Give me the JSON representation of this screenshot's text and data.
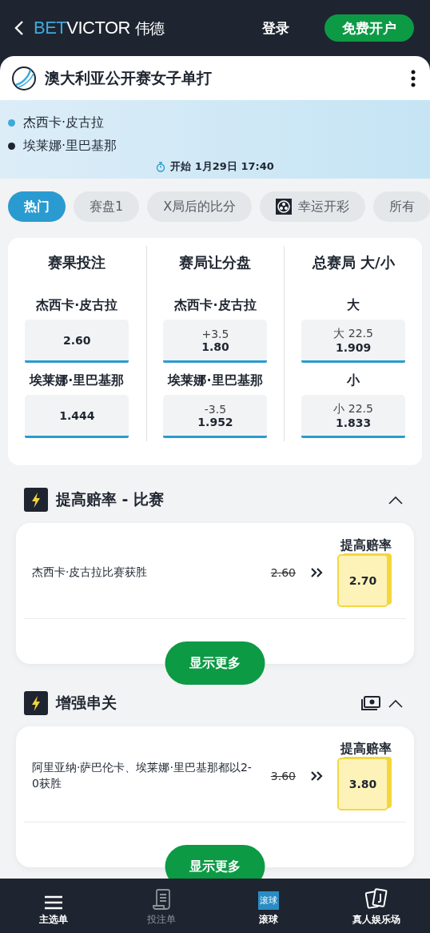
{
  "header": {
    "brand_bet": "BET",
    "brand_victor": "VICTOR",
    "brand_cn": "伟德",
    "login": "登录",
    "signup": "免费开户"
  },
  "event": {
    "title": "澳大利亚公开赛女子单打",
    "players": [
      {
        "name": "杰西卡·皮古拉",
        "color": "#3fa9dc"
      },
      {
        "name": "埃莱娜·里巴基那",
        "color": "#1e2530"
      }
    ],
    "start": "开始 1月29日 17:40"
  },
  "tabs": [
    {
      "label": "热门",
      "selected": true,
      "kind": "text"
    },
    {
      "label": "赛盘1",
      "selected": false,
      "kind": "text"
    },
    {
      "label": "X局后的比分",
      "selected": false,
      "kind": "text"
    },
    {
      "label": "幸运开彩",
      "selected": false,
      "kind": "lottery"
    },
    {
      "label": "所有",
      "selected": false,
      "kind": "text"
    }
  ],
  "markets": [
    {
      "title": "赛果投注",
      "selections": [
        {
          "label": "杰西卡·皮古拉",
          "odds": "2.60"
        },
        {
          "label": "埃莱娜·里巴基那",
          "odds": "1.444"
        }
      ]
    },
    {
      "title": "赛局让分盘",
      "selections": [
        {
          "label": "杰西卡·皮古拉",
          "line": "+3.5",
          "odds": "1.80"
        },
        {
          "label": "埃莱娜·里巴基那",
          "line": "-3.5",
          "odds": "1.952"
        }
      ]
    },
    {
      "title": "总赛局 大/小",
      "selections": [
        {
          "label": "大",
          "line": "大 22.5",
          "odds": "1.909"
        },
        {
          "label": "小",
          "line": "小 22.5",
          "odds": "1.833"
        }
      ]
    }
  ],
  "boost_sections": [
    {
      "title": "提高赔率 - 比赛",
      "cash_icon": false,
      "expanded": true,
      "items": [
        {
          "description": "杰西卡·皮古拉比赛获胜",
          "old_odds": "2.60",
          "boost_label": "提高赔率",
          "new_odds": "2.70"
        }
      ],
      "button": "显示更多"
    },
    {
      "title": "增强串关",
      "cash_icon": true,
      "expanded": true,
      "items": [
        {
          "description": "阿里亚纳·萨巴伦卡、埃莱娜·里巴基那都以2-0获胜",
          "old_odds": "3.60",
          "boost_label": "提高赔率",
          "new_odds": "3.80"
        }
      ],
      "button": "显示更多"
    }
  ],
  "bottom_nav": [
    {
      "label": "主选单",
      "kind": "menu",
      "disabled": false
    },
    {
      "label": "投注单",
      "kind": "slip",
      "disabled": true
    },
    {
      "label": "滚球",
      "kind": "live",
      "icon_text": "滚球",
      "disabled": false
    },
    {
      "label": "真人娱乐场",
      "kind": "cards",
      "disabled": false
    }
  ]
}
